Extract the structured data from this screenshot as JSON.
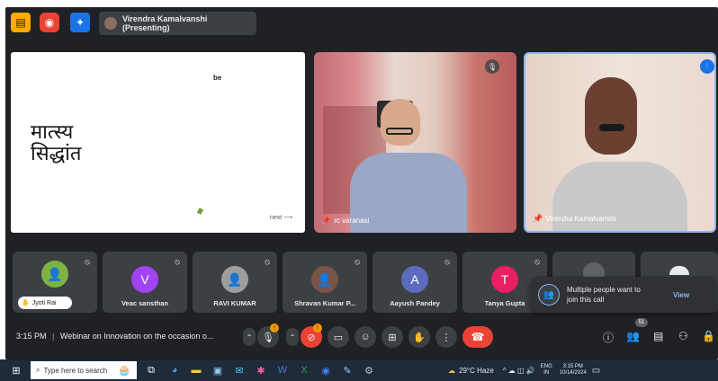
{
  "topbar": {
    "presenter_label": "Virendra Kamalvanshi (Presenting)",
    "icons": [
      "document-icon",
      "record-icon",
      "effects-icon"
    ]
  },
  "slide": {
    "title_line1": "मात्स्य",
    "title_line2": "सिद्धांत",
    "corner_text": "be",
    "next_text": "next ⟶"
  },
  "video_tiles": [
    {
      "name": "rc varanasi"
    },
    {
      "name": "Virendra Kamalvanshi"
    }
  ],
  "participants": [
    {
      "name": "Jyoti Rai",
      "type": "photo",
      "color": "#7cb342"
    },
    {
      "name": "Veac sansthan",
      "initial": "V",
      "color": "#a142f4"
    },
    {
      "name": "RAVI KUMAR",
      "type": "photo",
      "color": "#9e9e9e"
    },
    {
      "name": "Shravan Kumar P...",
      "type": "photo",
      "color": "#795548"
    },
    {
      "name": "Aayush Pandey",
      "initial": "A",
      "color": "#5c6bc0"
    },
    {
      "name": "Tanya Gupta",
      "initial": "T",
      "color": "#e91e63"
    }
  ],
  "notification": {
    "text_line1": "Multiple people want to",
    "text_line2": "join this call",
    "action": "View"
  },
  "meeting": {
    "time": "3:15 PM",
    "separator": "|",
    "title": "Webinar on Innovation on the occasion o...",
    "people_count": "51",
    "mic_badge": "!",
    "cam_badge": "!"
  },
  "taskbar": {
    "search_placeholder": "Type here to search",
    "weather": "29°C  Haze",
    "lang_line1": "ENG",
    "lang_line2": "IN",
    "clock_time": "3:15 PM",
    "clock_date": "10/14/2024"
  },
  "colors": {
    "meet_bg": "#202124",
    "tile_bg": "#3c4043",
    "end_call": "#ea4335",
    "accent": "#8ab4f8"
  }
}
